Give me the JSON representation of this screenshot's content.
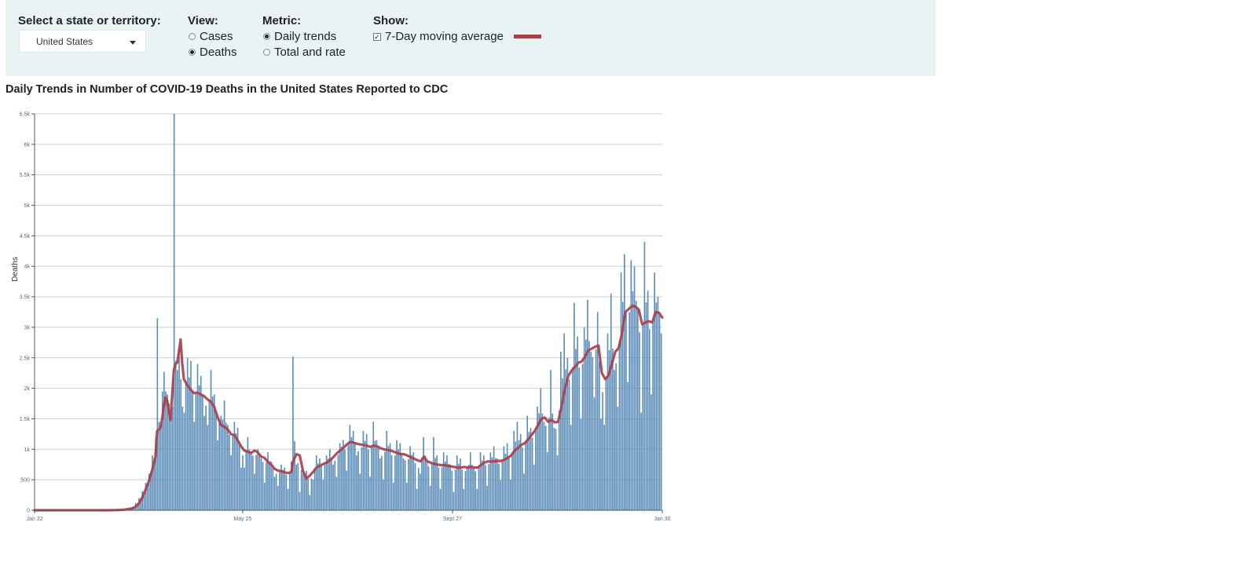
{
  "controls": {
    "state_label": "Select a state or territory:",
    "state_value": "United States",
    "view_label": "View:",
    "view_options": [
      "Cases",
      "Deaths"
    ],
    "view_selected": "Deaths",
    "metric_label": "Metric:",
    "metric_options": [
      "Daily trends",
      "Total and rate"
    ],
    "metric_selected": "Daily trends",
    "show_label": "Show:",
    "show_option": "7-Day moving average",
    "show_checked": true
  },
  "colors": {
    "bar": "#5b8db8",
    "moving_average": "#a8404c",
    "panel": "#eaf3f4"
  },
  "chart_data": {
    "type": "bar",
    "title": "Daily Trends in Number of COVID-19 Deaths in the United States Reported to CDC",
    "ylabel": "Deaths",
    "xlabel": "",
    "ylim": [
      0,
      6500
    ],
    "y_ticks": [
      "0",
      "500",
      "1k",
      "1.5k",
      "2k",
      "2.5k",
      "3k",
      "3.5k",
      "4k",
      "4.5k",
      "5k",
      "5.5k",
      "6k",
      "6.5k"
    ],
    "x_ticks": [
      "Jan 22",
      "May 25",
      "Sept 27",
      "Jan 30"
    ],
    "x_range": [
      "2020-01-22",
      "2021-01-30"
    ],
    "grid": true,
    "series": [
      {
        "name": "Daily deaths",
        "kind": "bar"
      },
      {
        "name": "7-Day moving average",
        "kind": "line"
      }
    ],
    "points": [
      [
        "2020-01-22",
        0,
        0
      ],
      [
        "2020-02-05",
        0,
        0
      ],
      [
        "2020-02-20",
        0,
        0
      ],
      [
        "2020-03-05",
        0,
        0
      ],
      [
        "2020-03-10",
        4,
        2
      ],
      [
        "2020-03-15",
        15,
        8
      ],
      [
        "2020-03-20",
        50,
        30
      ],
      [
        "2020-03-22",
        120,
        55
      ],
      [
        "2020-03-24",
        200,
        110
      ],
      [
        "2020-03-26",
        310,
        200
      ],
      [
        "2020-03-28",
        450,
        330
      ],
      [
        "2020-03-30",
        600,
        470
      ],
      [
        "2020-04-01",
        900,
        650
      ],
      [
        "2020-04-03",
        1200,
        870
      ],
      [
        "2020-04-04",
        3150,
        1300
      ],
      [
        "2020-04-05",
        1450,
        1320
      ],
      [
        "2020-04-06",
        1350,
        1350
      ],
      [
        "2020-04-07",
        1950,
        1500
      ],
      [
        "2020-04-08",
        2270,
        1700
      ],
      [
        "2020-04-09",
        1950,
        1850
      ],
      [
        "2020-04-10",
        1900,
        1800
      ],
      [
        "2020-04-11",
        1750,
        1620
      ],
      [
        "2020-04-12",
        1550,
        1480
      ],
      [
        "2020-04-13",
        1700,
        1900
      ],
      [
        "2020-04-14",
        6500,
        2300
      ],
      [
        "2020-04-15",
        2450,
        2400
      ],
      [
        "2020-04-16",
        2300,
        2420
      ],
      [
        "2020-04-17",
        2650,
        2600
      ],
      [
        "2020-04-18",
        2150,
        2800
      ],
      [
        "2020-04-19",
        1700,
        2400
      ],
      [
        "2020-04-20",
        1600,
        2150
      ],
      [
        "2020-04-22",
        2500,
        2050
      ],
      [
        "2020-04-24",
        2450,
        1980
      ],
      [
        "2020-04-26",
        1450,
        1920
      ],
      [
        "2020-04-28",
        2400,
        1930
      ],
      [
        "2020-04-30",
        2200,
        1900
      ],
      [
        "2020-05-02",
        1550,
        1870
      ],
      [
        "2020-05-04",
        1400,
        1820
      ],
      [
        "2020-05-06",
        2300,
        1780
      ],
      [
        "2020-05-08",
        1900,
        1700
      ],
      [
        "2020-05-10",
        1150,
        1530
      ],
      [
        "2020-05-12",
        1550,
        1400
      ],
      [
        "2020-05-14",
        1800,
        1370
      ],
      [
        "2020-05-16",
        1400,
        1330
      ],
      [
        "2020-05-18",
        900,
        1250
      ],
      [
        "2020-05-20",
        1450,
        1230
      ],
      [
        "2020-05-22",
        1350,
        1150
      ],
      [
        "2020-05-24",
        700,
        1050
      ],
      [
        "2020-05-26",
        700,
        980
      ],
      [
        "2020-05-28",
        1200,
        960
      ],
      [
        "2020-05-30",
        950,
        940
      ],
      [
        "2020-06-01",
        600,
        980
      ],
      [
        "2020-06-03",
        1000,
        950
      ],
      [
        "2020-06-05",
        850,
        880
      ],
      [
        "2020-06-07",
        450,
        860
      ],
      [
        "2020-06-09",
        950,
        790
      ],
      [
        "2020-06-11",
        800,
        750
      ],
      [
        "2020-06-13",
        550,
        680
      ],
      [
        "2020-06-15",
        400,
        650
      ],
      [
        "2020-06-17",
        750,
        640
      ],
      [
        "2020-06-19",
        700,
        620
      ],
      [
        "2020-06-21",
        350,
        610
      ],
      [
        "2020-06-23",
        800,
        630
      ],
      [
        "2020-06-24",
        2520,
        800
      ],
      [
        "2020-06-26",
        750,
        920
      ],
      [
        "2020-06-28",
        300,
        900
      ],
      [
        "2020-06-30",
        600,
        640
      ],
      [
        "2020-07-02",
        650,
        520
      ],
      [
        "2020-07-04",
        250,
        570
      ],
      [
        "2020-07-06",
        500,
        630
      ],
      [
        "2020-07-08",
        900,
        700
      ],
      [
        "2020-07-10",
        850,
        730
      ],
      [
        "2020-07-12",
        500,
        760
      ],
      [
        "2020-07-14",
        900,
        780
      ],
      [
        "2020-07-16",
        1000,
        820
      ],
      [
        "2020-07-18",
        750,
        870
      ],
      [
        "2020-07-20",
        550,
        930
      ],
      [
        "2020-07-22",
        1100,
        980
      ],
      [
        "2020-07-24",
        1150,
        1020
      ],
      [
        "2020-07-26",
        650,
        1080
      ],
      [
        "2020-07-28",
        1400,
        1120
      ],
      [
        "2020-07-30",
        1300,
        1110
      ],
      [
        "2020-08-01",
        900,
        1090
      ],
      [
        "2020-08-03",
        600,
        1080
      ],
      [
        "2020-08-05",
        1300,
        1070
      ],
      [
        "2020-08-07",
        1250,
        1060
      ],
      [
        "2020-08-09",
        550,
        1040
      ],
      [
        "2020-08-11",
        1450,
        1060
      ],
      [
        "2020-08-13",
        1150,
        1050
      ],
      [
        "2020-08-15",
        850,
        1020
      ],
      [
        "2020-08-17",
        500,
        1000
      ],
      [
        "2020-08-19",
        1300,
        990
      ],
      [
        "2020-08-21",
        1100,
        980
      ],
      [
        "2020-08-23",
        450,
        960
      ],
      [
        "2020-08-25",
        1150,
        940
      ],
      [
        "2020-08-27",
        1100,
        920
      ],
      [
        "2020-08-29",
        850,
        920
      ],
      [
        "2020-08-31",
        450,
        900
      ],
      [
        "2020-09-02",
        1050,
        870
      ],
      [
        "2020-09-04",
        950,
        850
      ],
      [
        "2020-09-06",
        350,
        820
      ],
      [
        "2020-09-08",
        600,
        800
      ],
      [
        "2020-09-10",
        1200,
        880
      ],
      [
        "2020-09-12",
        800,
        800
      ],
      [
        "2020-09-14",
        400,
        780
      ],
      [
        "2020-09-16",
        1200,
        760
      ],
      [
        "2020-09-18",
        900,
        750
      ],
      [
        "2020-09-20",
        350,
        740
      ],
      [
        "2020-09-22",
        950,
        740
      ],
      [
        "2020-09-24",
        900,
        730
      ],
      [
        "2020-09-26",
        750,
        720
      ],
      [
        "2020-09-28",
        300,
        710
      ],
      [
        "2020-09-30",
        900,
        700
      ],
      [
        "2020-10-02",
        850,
        700
      ],
      [
        "2020-10-04",
        350,
        710
      ],
      [
        "2020-10-06",
        700,
        700
      ],
      [
        "2020-10-08",
        950,
        710
      ],
      [
        "2020-10-10",
        700,
        700
      ],
      [
        "2020-10-12",
        350,
        700
      ],
      [
        "2020-10-14",
        950,
        740
      ],
      [
        "2020-10-16",
        900,
        780
      ],
      [
        "2020-10-18",
        400,
        800
      ],
      [
        "2020-10-20",
        950,
        800
      ],
      [
        "2020-10-22",
        1050,
        800
      ],
      [
        "2020-10-24",
        850,
        810
      ],
      [
        "2020-10-26",
        500,
        810
      ],
      [
        "2020-10-28",
        1050,
        830
      ],
      [
        "2020-10-30",
        1100,
        860
      ],
      [
        "2020-11-01",
        500,
        900
      ],
      [
        "2020-11-03",
        1300,
        980
      ],
      [
        "2020-11-05",
        1450,
        1020
      ],
      [
        "2020-11-07",
        1250,
        1070
      ],
      [
        "2020-11-09",
        600,
        1100
      ],
      [
        "2020-11-11",
        1550,
        1160
      ],
      [
        "2020-11-13",
        1350,
        1230
      ],
      [
        "2020-11-15",
        750,
        1300
      ],
      [
        "2020-11-17",
        1700,
        1400
      ],
      [
        "2020-11-19",
        2000,
        1500
      ],
      [
        "2020-11-21",
        1450,
        1520
      ],
      [
        "2020-11-23",
        950,
        1450
      ],
      [
        "2020-11-25",
        2300,
        1480
      ],
      [
        "2020-11-27",
        1350,
        1440
      ],
      [
        "2020-11-29",
        900,
        1450
      ],
      [
        "2020-12-01",
        2600,
        1700
      ],
      [
        "2020-12-03",
        2900,
        2000
      ],
      [
        "2020-12-05",
        2500,
        2200
      ],
      [
        "2020-12-07",
        1400,
        2290
      ],
      [
        "2020-12-09",
        3400,
        2350
      ],
      [
        "2020-12-11",
        2850,
        2420
      ],
      [
        "2020-12-13",
        1500,
        2440
      ],
      [
        "2020-12-15",
        3000,
        2520
      ],
      [
        "2020-12-17",
        3450,
        2620
      ],
      [
        "2020-12-19",
        2600,
        2650
      ],
      [
        "2020-12-21",
        1850,
        2680
      ],
      [
        "2020-12-23",
        3250,
        2700
      ],
      [
        "2020-12-25",
        1500,
        2250
      ],
      [
        "2020-12-27",
        1400,
        2150
      ],
      [
        "2020-12-29",
        2900,
        2210
      ],
      [
        "2020-12-31",
        3550,
        2400
      ],
      [
        "2021-01-02",
        2300,
        2600
      ],
      [
        "2021-01-04",
        1700,
        2660
      ],
      [
        "2021-01-06",
        3900,
        2900
      ],
      [
        "2021-01-08",
        4200,
        3250
      ],
      [
        "2021-01-10",
        2100,
        3300
      ],
      [
        "2021-01-12",
        4100,
        3350
      ],
      [
        "2021-01-14",
        4000,
        3340
      ],
      [
        "2021-01-16",
        3300,
        3290
      ],
      [
        "2021-01-18",
        1600,
        3050
      ],
      [
        "2021-01-20",
        4400,
        3080
      ],
      [
        "2021-01-22",
        3600,
        3100
      ],
      [
        "2021-01-24",
        1900,
        3080
      ],
      [
        "2021-01-26",
        3900,
        3250
      ],
      [
        "2021-01-28",
        3500,
        3240
      ],
      [
        "2021-01-30",
        2900,
        3160
      ]
    ]
  }
}
